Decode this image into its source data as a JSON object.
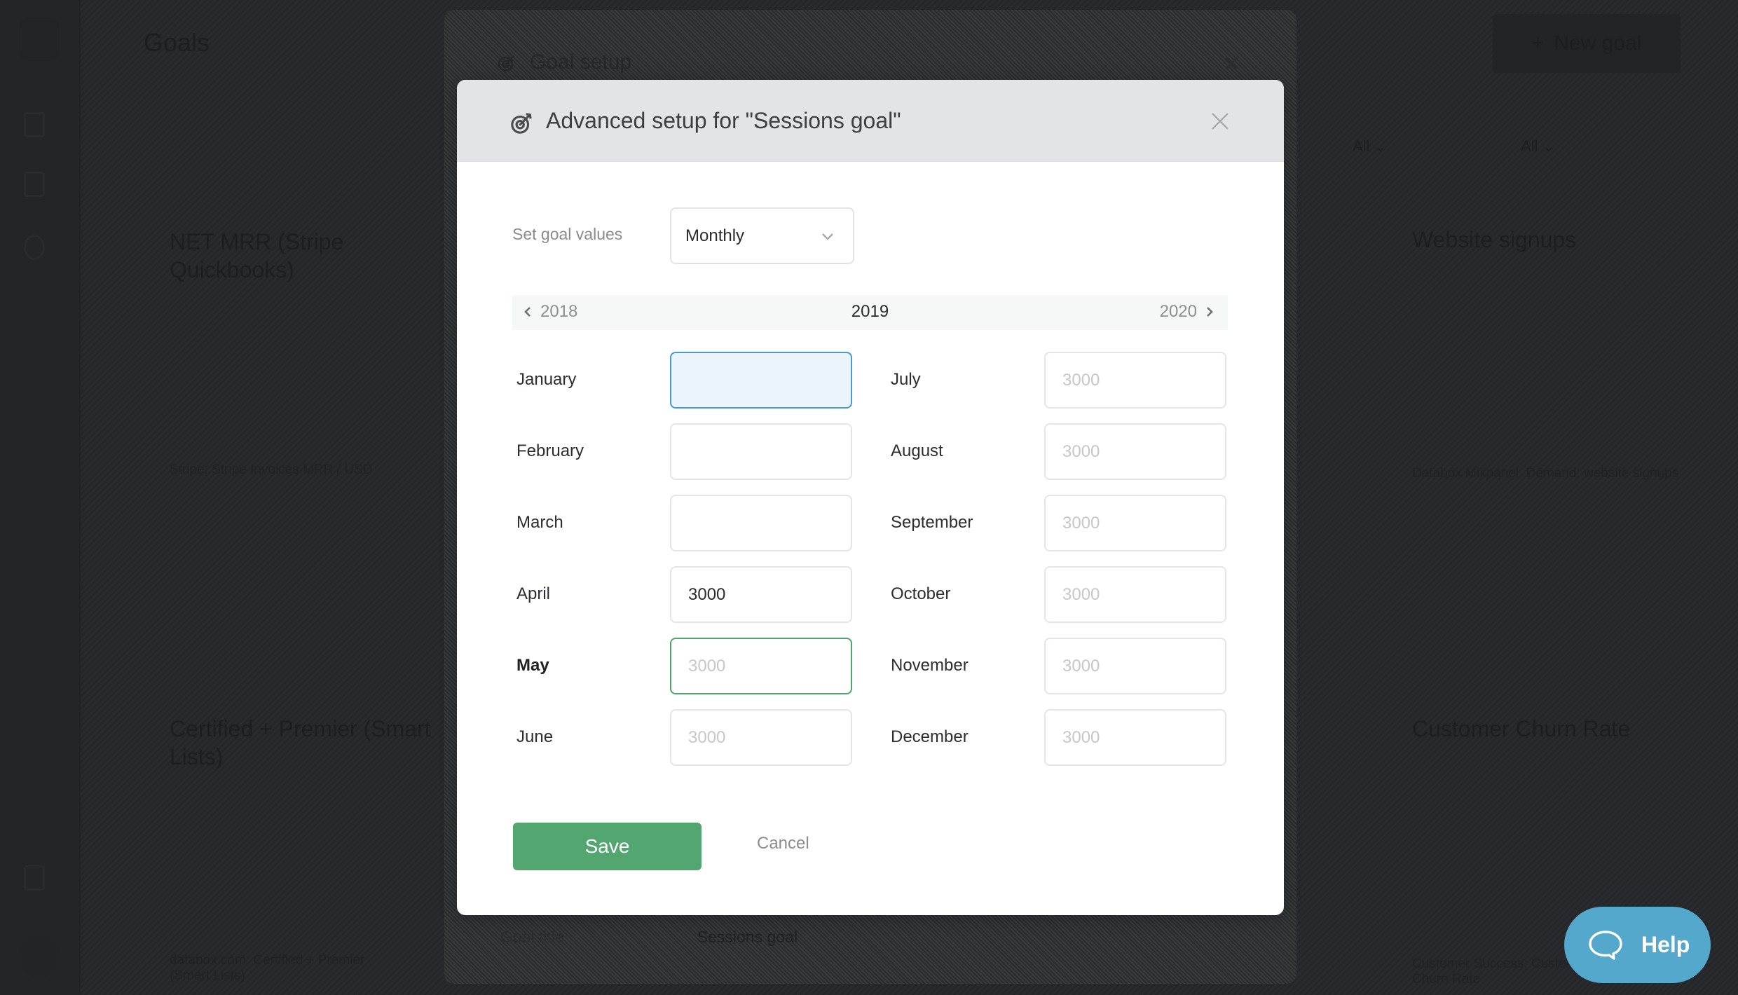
{
  "background": {
    "page_title": "Goals",
    "new_goal_button": "New goal",
    "filters": [
      {
        "label": "All"
      },
      {
        "label": "All"
      }
    ],
    "cards": [
      {
        "title": "NET MRR (Stripe Quickbooks)",
        "subtitle": "Stripe: Stripe Invoices MRR / USD"
      },
      {
        "title": "Website signups",
        "subtitle": "Databox Mixpanel: Demand: website signups"
      },
      {
        "title": "Certified + Premier (Smart Lists)",
        "subtitle": "databox.com: Certified + Premier (Smart Lists)"
      },
      {
        "title": "Customer Churn Rate",
        "subtitle": "Customer Success: Customer Churn Rate"
      }
    ]
  },
  "parent_dialog": {
    "title": "Goal setup",
    "goal_title_label": "Goal title",
    "goal_title_value": "Sessions goal"
  },
  "dialog": {
    "title": "Advanced setup for \"Sessions goal\"",
    "title_icon": "target-arrow-icon",
    "set_goal_values_label": "Set goal values",
    "period_select": {
      "selected": "Monthly"
    },
    "year_nav": {
      "prev": "2018",
      "current": "2019",
      "next": "2020"
    },
    "months": [
      {
        "label": "January",
        "value": "",
        "placeholder": "",
        "state": "focused"
      },
      {
        "label": "February",
        "value": "",
        "placeholder": "",
        "state": "default"
      },
      {
        "label": "March",
        "value": "",
        "placeholder": "",
        "state": "default"
      },
      {
        "label": "April",
        "value": "3000",
        "placeholder": "",
        "state": "default"
      },
      {
        "label": "May",
        "value": "",
        "placeholder": "3000",
        "state": "current"
      },
      {
        "label": "June",
        "value": "",
        "placeholder": "3000",
        "state": "default"
      },
      {
        "label": "July",
        "value": "",
        "placeholder": "3000",
        "state": "default"
      },
      {
        "label": "August",
        "value": "",
        "placeholder": "3000",
        "state": "default"
      },
      {
        "label": "September",
        "value": "",
        "placeholder": "3000",
        "state": "default"
      },
      {
        "label": "October",
        "value": "",
        "placeholder": "3000",
        "state": "default"
      },
      {
        "label": "November",
        "value": "",
        "placeholder": "3000",
        "state": "default"
      },
      {
        "label": "December",
        "value": "",
        "placeholder": "3000",
        "state": "default"
      }
    ],
    "save_label": "Save",
    "cancel_label": "Cancel"
  },
  "help_widget": {
    "label": "Help"
  },
  "colors": {
    "primary_green": "#53a670",
    "focus_blue": "#4a9ad0",
    "help_blue": "#54a8cb",
    "header_gray": "#e3e4e6"
  }
}
